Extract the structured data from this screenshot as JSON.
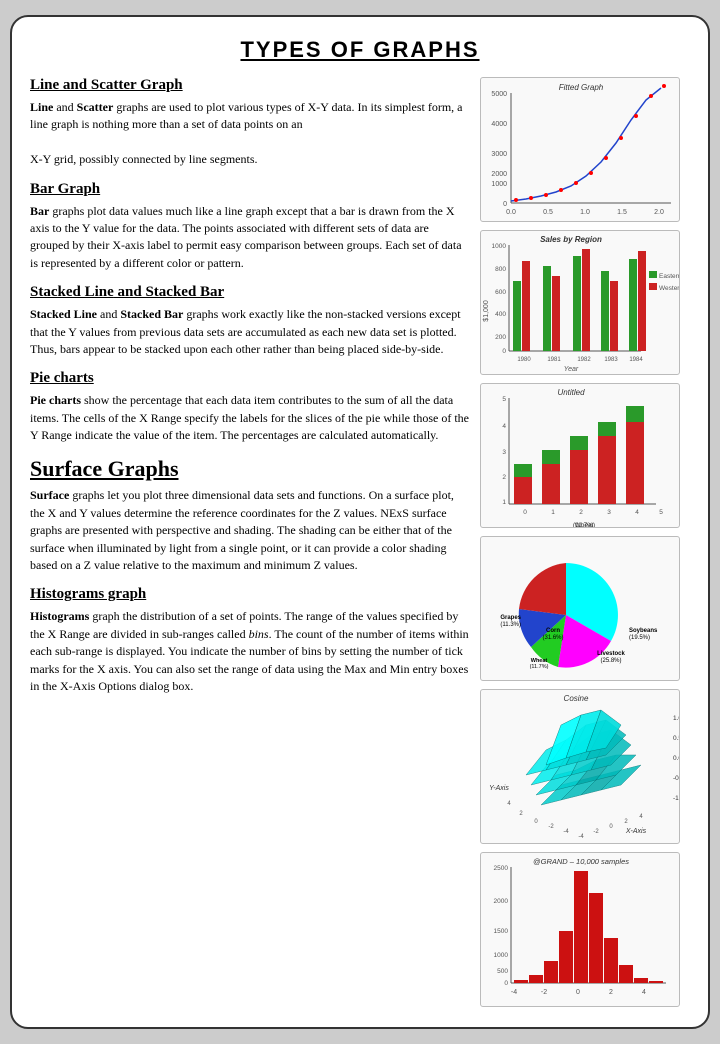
{
  "page": {
    "title": "TYPES OF GRAPHS",
    "sections": [
      {
        "id": "line-scatter",
        "title": "Line and Scatter Graph",
        "body": "<b>Line</b> and <b>Scatter</b> graphs are used to plot various types of X-Y data. In its simplest form, a line graph is nothing more than a set of data points on an X-Y grid, possibly connected by line segments."
      },
      {
        "id": "bar-graph",
        "title": "Bar Graph",
        "body": "<b>Bar</b> graphs plot data values much like a line graph except that a bar is drawn from the X axis to the Y value for the data. The points associated with different sets of data are grouped by their X-axis label to permit easy comparison between groups. Each set of data is represented by a different color or pattern."
      },
      {
        "id": "stacked",
        "title": "Stacked Line and Stacked Bar",
        "body": "<b>Stacked Line</b> and <b>Stacked Bar</b> graphs work exactly like the non-stacked versions except that the Y values from previous data sets are accumulated as each new data set is plotted. Thus, bars appear to be stacked upon each other rather than being placed side-by-side."
      },
      {
        "id": "pie",
        "title": "Pie charts",
        "body": "<b>Pie charts</b> show the percentage that each data item contributes to the sum of all the data items. The cells of the X Range specify the labels for the slices of the pie while those of the Y Range indicate the value of the item. The percentages are calculated automatically."
      },
      {
        "id": "surface",
        "title": "Surface Graphs",
        "large": true,
        "body": "<b>Surface</b> graphs let you plot three dimensional data sets and functions. On a surface plot, the X and Y values determine the reference coordinates for the Z values. NExS surface graphs are presented with perspective and shading. The shading can be either that of the surface when illuminated by light from a single point, or it can provide a color shading based on a Z value relative to the maximum and minimum Z values."
      },
      {
        "id": "histogram",
        "title": "Histograms graph",
        "body": "<b>Histograms</b> graph the distribution of a set of points. The range of the values specified by the X Range are divided in sub-ranges called <i>bins</i>. The count of the number of items within each sub-range is displayed. You indicate the number of bins by setting the number of tick marks for the X axis. You can also set the range of data using the Max and Min entry boxes in the X-Axis Options dialog box."
      }
    ]
  }
}
